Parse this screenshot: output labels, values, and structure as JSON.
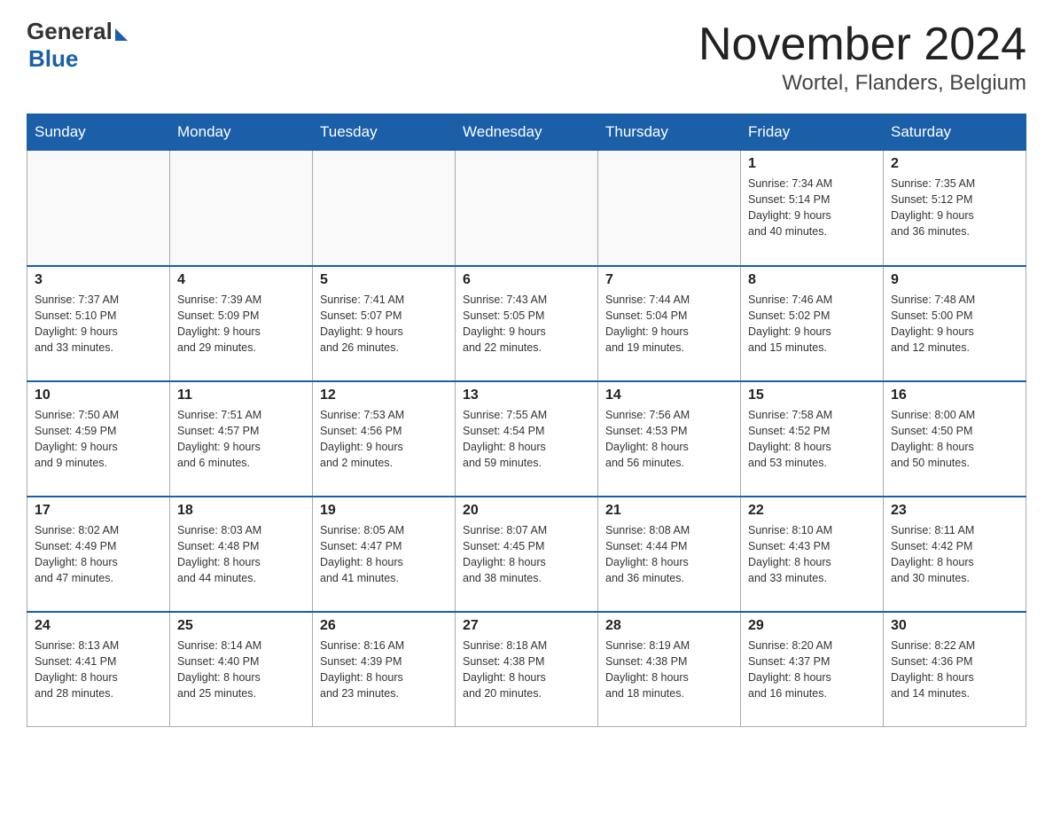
{
  "logo": {
    "general": "General",
    "blue": "Blue"
  },
  "title": "November 2024",
  "subtitle": "Wortel, Flanders, Belgium",
  "days_header": [
    "Sunday",
    "Monday",
    "Tuesday",
    "Wednesday",
    "Thursday",
    "Friday",
    "Saturday"
  ],
  "weeks": [
    [
      {
        "day": "",
        "info": ""
      },
      {
        "day": "",
        "info": ""
      },
      {
        "day": "",
        "info": ""
      },
      {
        "day": "",
        "info": ""
      },
      {
        "day": "",
        "info": ""
      },
      {
        "day": "1",
        "info": "Sunrise: 7:34 AM\nSunset: 5:14 PM\nDaylight: 9 hours\nand 40 minutes."
      },
      {
        "day": "2",
        "info": "Sunrise: 7:35 AM\nSunset: 5:12 PM\nDaylight: 9 hours\nand 36 minutes."
      }
    ],
    [
      {
        "day": "3",
        "info": "Sunrise: 7:37 AM\nSunset: 5:10 PM\nDaylight: 9 hours\nand 33 minutes."
      },
      {
        "day": "4",
        "info": "Sunrise: 7:39 AM\nSunset: 5:09 PM\nDaylight: 9 hours\nand 29 minutes."
      },
      {
        "day": "5",
        "info": "Sunrise: 7:41 AM\nSunset: 5:07 PM\nDaylight: 9 hours\nand 26 minutes."
      },
      {
        "day": "6",
        "info": "Sunrise: 7:43 AM\nSunset: 5:05 PM\nDaylight: 9 hours\nand 22 minutes."
      },
      {
        "day": "7",
        "info": "Sunrise: 7:44 AM\nSunset: 5:04 PM\nDaylight: 9 hours\nand 19 minutes."
      },
      {
        "day": "8",
        "info": "Sunrise: 7:46 AM\nSunset: 5:02 PM\nDaylight: 9 hours\nand 15 minutes."
      },
      {
        "day": "9",
        "info": "Sunrise: 7:48 AM\nSunset: 5:00 PM\nDaylight: 9 hours\nand 12 minutes."
      }
    ],
    [
      {
        "day": "10",
        "info": "Sunrise: 7:50 AM\nSunset: 4:59 PM\nDaylight: 9 hours\nand 9 minutes."
      },
      {
        "day": "11",
        "info": "Sunrise: 7:51 AM\nSunset: 4:57 PM\nDaylight: 9 hours\nand 6 minutes."
      },
      {
        "day": "12",
        "info": "Sunrise: 7:53 AM\nSunset: 4:56 PM\nDaylight: 9 hours\nand 2 minutes."
      },
      {
        "day": "13",
        "info": "Sunrise: 7:55 AM\nSunset: 4:54 PM\nDaylight: 8 hours\nand 59 minutes."
      },
      {
        "day": "14",
        "info": "Sunrise: 7:56 AM\nSunset: 4:53 PM\nDaylight: 8 hours\nand 56 minutes."
      },
      {
        "day": "15",
        "info": "Sunrise: 7:58 AM\nSunset: 4:52 PM\nDaylight: 8 hours\nand 53 minutes."
      },
      {
        "day": "16",
        "info": "Sunrise: 8:00 AM\nSunset: 4:50 PM\nDaylight: 8 hours\nand 50 minutes."
      }
    ],
    [
      {
        "day": "17",
        "info": "Sunrise: 8:02 AM\nSunset: 4:49 PM\nDaylight: 8 hours\nand 47 minutes."
      },
      {
        "day": "18",
        "info": "Sunrise: 8:03 AM\nSunset: 4:48 PM\nDaylight: 8 hours\nand 44 minutes."
      },
      {
        "day": "19",
        "info": "Sunrise: 8:05 AM\nSunset: 4:47 PM\nDaylight: 8 hours\nand 41 minutes."
      },
      {
        "day": "20",
        "info": "Sunrise: 8:07 AM\nSunset: 4:45 PM\nDaylight: 8 hours\nand 38 minutes."
      },
      {
        "day": "21",
        "info": "Sunrise: 8:08 AM\nSunset: 4:44 PM\nDaylight: 8 hours\nand 36 minutes."
      },
      {
        "day": "22",
        "info": "Sunrise: 8:10 AM\nSunset: 4:43 PM\nDaylight: 8 hours\nand 33 minutes."
      },
      {
        "day": "23",
        "info": "Sunrise: 8:11 AM\nSunset: 4:42 PM\nDaylight: 8 hours\nand 30 minutes."
      }
    ],
    [
      {
        "day": "24",
        "info": "Sunrise: 8:13 AM\nSunset: 4:41 PM\nDaylight: 8 hours\nand 28 minutes."
      },
      {
        "day": "25",
        "info": "Sunrise: 8:14 AM\nSunset: 4:40 PM\nDaylight: 8 hours\nand 25 minutes."
      },
      {
        "day": "26",
        "info": "Sunrise: 8:16 AM\nSunset: 4:39 PM\nDaylight: 8 hours\nand 23 minutes."
      },
      {
        "day": "27",
        "info": "Sunrise: 8:18 AM\nSunset: 4:38 PM\nDaylight: 8 hours\nand 20 minutes."
      },
      {
        "day": "28",
        "info": "Sunrise: 8:19 AM\nSunset: 4:38 PM\nDaylight: 8 hours\nand 18 minutes."
      },
      {
        "day": "29",
        "info": "Sunrise: 8:20 AM\nSunset: 4:37 PM\nDaylight: 8 hours\nand 16 minutes."
      },
      {
        "day": "30",
        "info": "Sunrise: 8:22 AM\nSunset: 4:36 PM\nDaylight: 8 hours\nand 14 minutes."
      }
    ]
  ]
}
